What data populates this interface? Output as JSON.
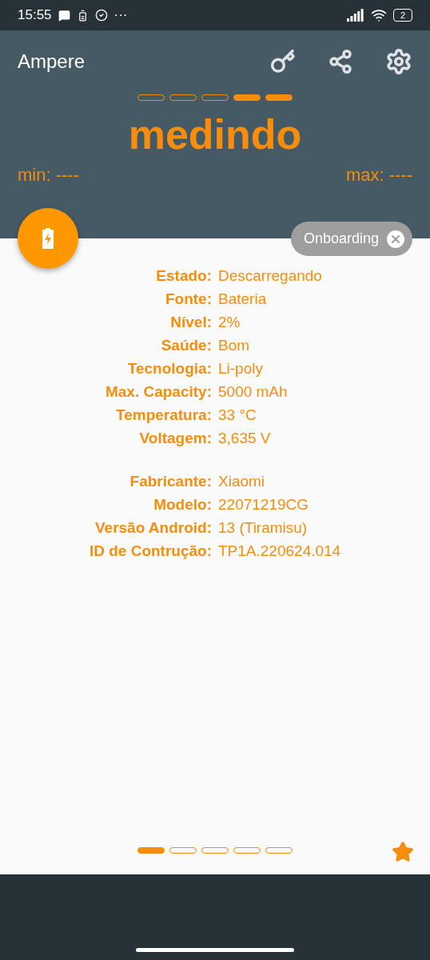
{
  "status_bar": {
    "time": "15:55",
    "more": "···",
    "battery": "2"
  },
  "app_bar": {
    "title": "Ampere"
  },
  "meter": {
    "segments": [
      {
        "on": false
      },
      {
        "on": false
      },
      {
        "on": false
      },
      {
        "on": true
      },
      {
        "on": true
      }
    ],
    "reading": "medindo",
    "min": "min: ----",
    "max": "max: ----"
  },
  "chip": {
    "label": "Onboarding"
  },
  "info_groups": [
    [
      {
        "label": "Estado:",
        "value": "Descarregando"
      },
      {
        "label": "Fonte:",
        "value": "Bateria"
      },
      {
        "label": "Nível:",
        "value": "2%"
      },
      {
        "label": "Saúde:",
        "value": "Bom"
      },
      {
        "label": "Tecnologia:",
        "value": "Li-poly"
      },
      {
        "label": "Max. Capacity:",
        "value": "5000 mAh"
      },
      {
        "label": "Temperatura:",
        "value": "33 °C"
      },
      {
        "label": "Voltagem:",
        "value": "3,635 V"
      }
    ],
    [
      {
        "label": "Fabricante:",
        "value": "Xiaomi"
      },
      {
        "label": "Modelo:",
        "value": "22071219CG"
      },
      {
        "label": "Versão Android:",
        "value": "13 (Tiramisu)"
      },
      {
        "label": "ID de Contrução:",
        "value": "TP1A.220624.014"
      }
    ]
  ],
  "pages": [
    {
      "selected": true
    },
    {
      "selected": false
    },
    {
      "selected": false
    },
    {
      "selected": false
    },
    {
      "selected": false
    }
  ]
}
